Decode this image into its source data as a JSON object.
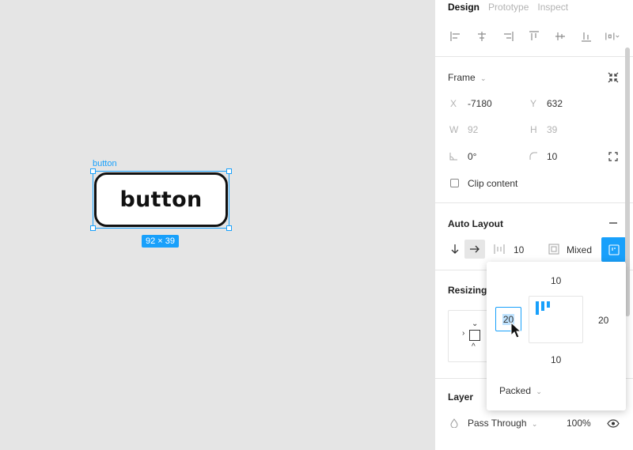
{
  "canvas": {
    "frame_label": "button",
    "button_text": "button",
    "size_badge": "92 × 39"
  },
  "panel": {
    "tabs": [
      "Design",
      "Prototype",
      "Inspect"
    ],
    "frame": {
      "title": "Frame",
      "x_label": "X",
      "x": "-7180",
      "y_label": "Y",
      "y": "632",
      "w_label": "W",
      "w": "92",
      "h_label": "H",
      "h": "39",
      "rotation": "0°",
      "radius": "10",
      "clip_label": "Clip content"
    },
    "auto_layout": {
      "title": "Auto Layout",
      "spacing": "10",
      "padding": "Mixed"
    },
    "resizing": {
      "title": "Resizing"
    },
    "layer": {
      "title": "Layer",
      "blend": "Pass Through",
      "opacity": "100%"
    }
  },
  "popover": {
    "top": "10",
    "left": "20",
    "right": "20",
    "bottom": "10",
    "distribution": "Packed"
  },
  "colors": {
    "accent": "#18a0fb",
    "canvas": "#e5e5e5"
  }
}
